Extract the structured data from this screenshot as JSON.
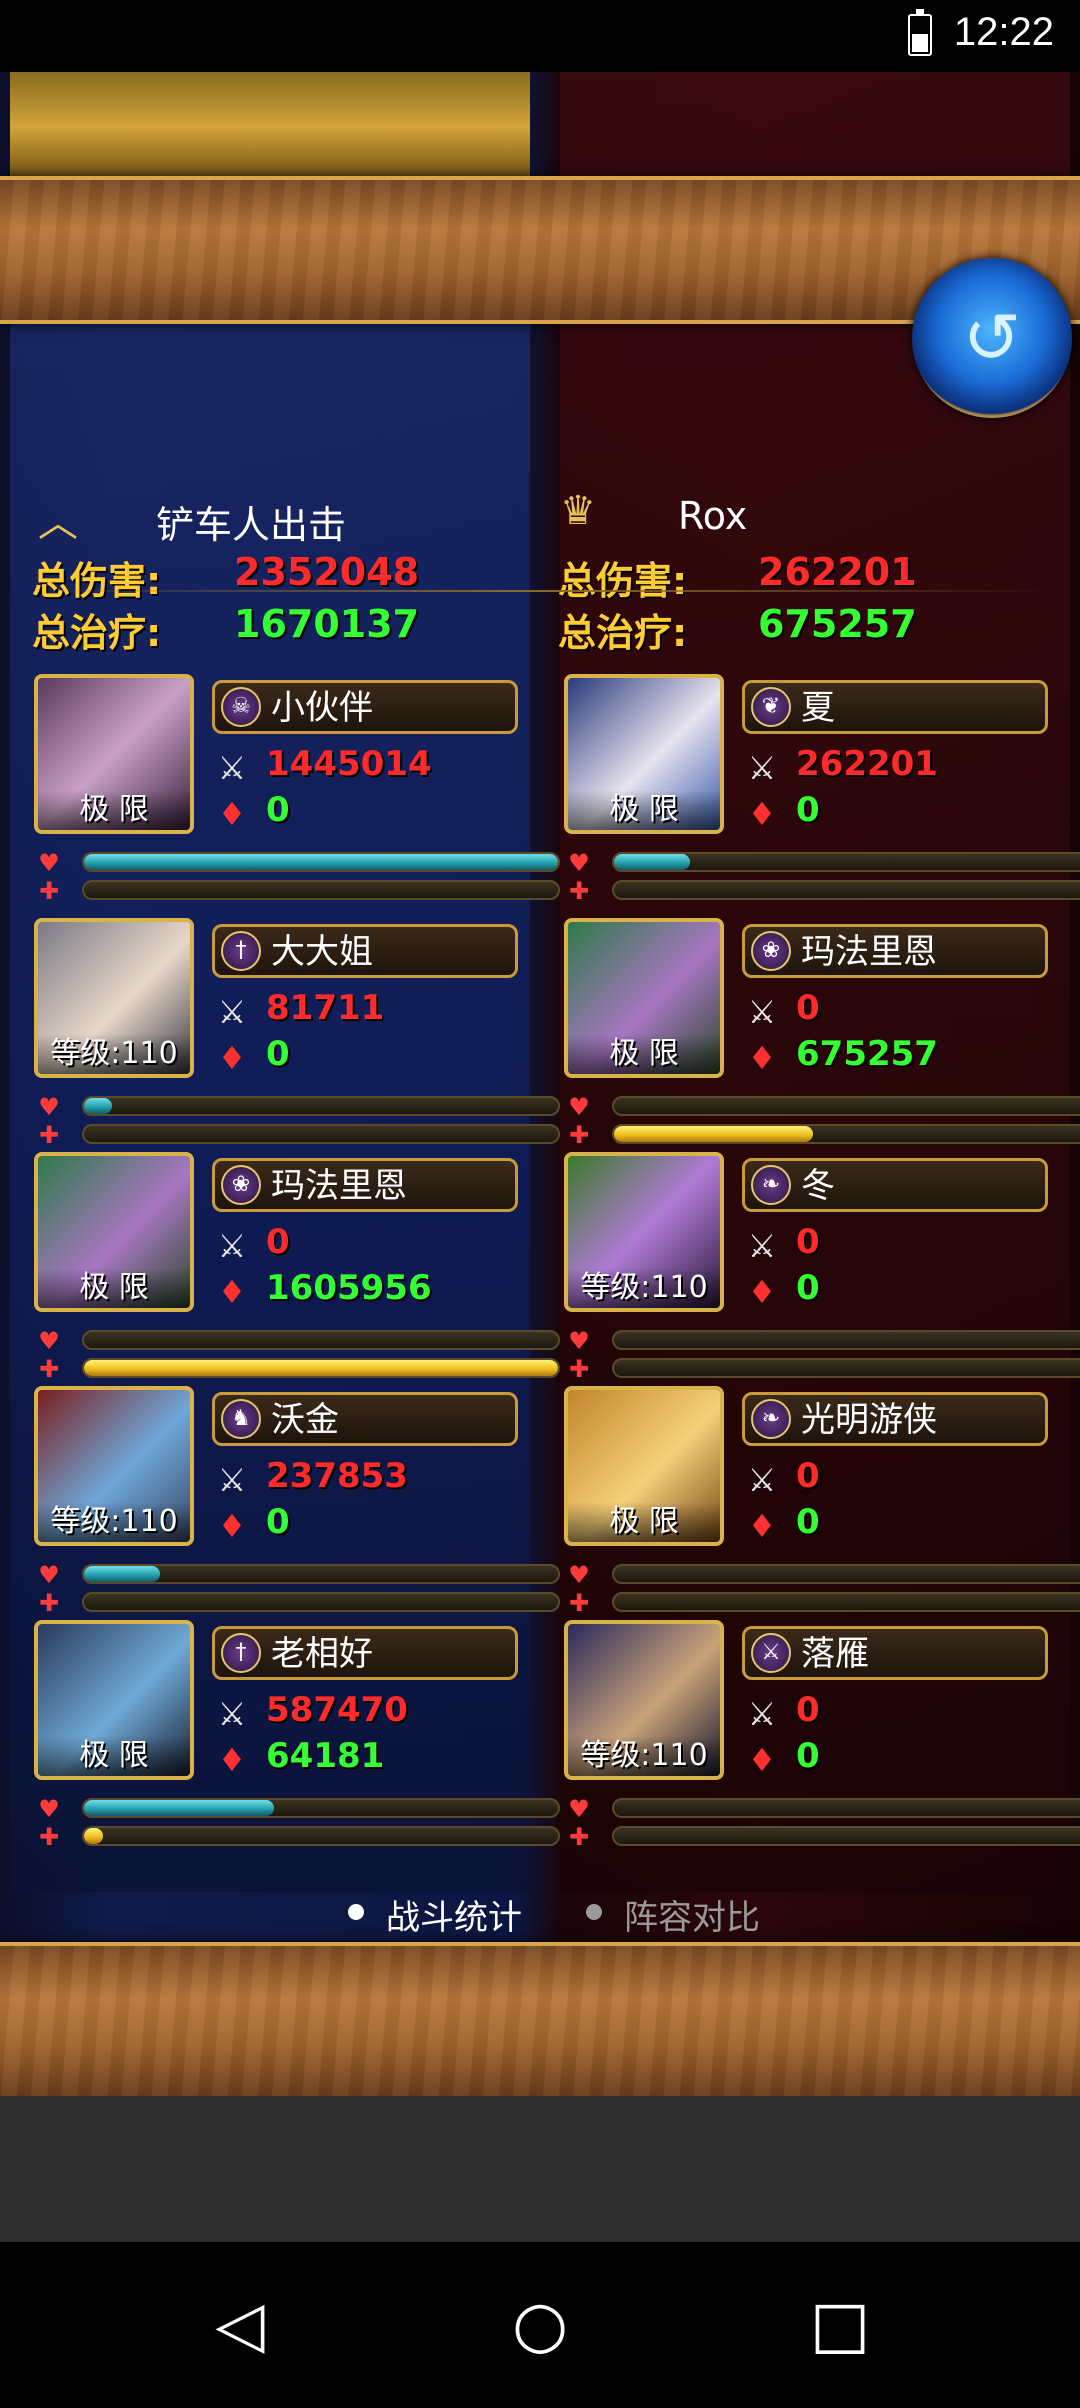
{
  "status_bar": {
    "time": "12:22",
    "battery_icon": "battery-icon"
  },
  "back_button": {
    "icon": "swirl-back-icon"
  },
  "left_team": {
    "name": "铲车人出击",
    "total_damage_label": "总伤害:",
    "total_damage": "2352048",
    "total_heal_label": "总治疗:",
    "total_heal": "1670137",
    "heroes": [
      {
        "name": "小伙伴",
        "badge": "极 限",
        "damage": "1445014",
        "heal": "0",
        "damage_fraction": 1.0,
        "heal_fraction": 0.0,
        "class_icon": "skull-icon"
      },
      {
        "name": "大大姐",
        "badge": "等级:110",
        "damage": "81711",
        "heal": "0",
        "damage_fraction": 0.06,
        "heal_fraction": 0.0,
        "class_icon": "dagger-icon"
      },
      {
        "name": "玛法里恩",
        "badge": "极 限",
        "damage": "0",
        "heal": "1605956",
        "damage_fraction": 0.0,
        "heal_fraction": 1.0,
        "class_icon": "paw-icon"
      },
      {
        "name": "沃金",
        "badge": "等级:110",
        "damage": "237853",
        "heal": "0",
        "damage_fraction": 0.16,
        "heal_fraction": 0.0,
        "class_icon": "warrior-icon"
      },
      {
        "name": "老相好",
        "badge": "极 限",
        "damage": "587470",
        "heal": "64181",
        "damage_fraction": 0.4,
        "heal_fraction": 0.04,
        "class_icon": "dagger-icon"
      }
    ]
  },
  "right_team": {
    "name": "Rox",
    "total_damage_label": "总伤害:",
    "total_damage": "262201",
    "total_heal_label": "总治疗:",
    "total_heal": "675257",
    "heroes": [
      {
        "name": "夏",
        "badge": "极 限",
        "damage": "262201",
        "heal": "0",
        "damage_fraction": 0.16,
        "heal_fraction": 0.0,
        "class_icon": "feather-icon"
      },
      {
        "name": "玛法里恩",
        "badge": "极 限",
        "damage": "0",
        "heal": "675257",
        "damage_fraction": 0.0,
        "heal_fraction": 0.42,
        "class_icon": "paw-icon"
      },
      {
        "name": "冬",
        "badge": "等级:110",
        "damage": "0",
        "heal": "0",
        "damage_fraction": 0.0,
        "heal_fraction": 0.0,
        "class_icon": "leaf-icon"
      },
      {
        "name": "光明游侠",
        "badge": "极 限",
        "damage": "0",
        "heal": "0",
        "damage_fraction": 0.0,
        "heal_fraction": 0.0,
        "class_icon": "leaf-icon"
      },
      {
        "name": "落雁",
        "badge": "等级:110",
        "damage": "0",
        "heal": "0",
        "damage_fraction": 0.0,
        "heal_fraction": 0.0,
        "class_icon": "crossed-swords-icon"
      }
    ]
  },
  "tabs": [
    {
      "label": "战斗统计",
      "active": true
    },
    {
      "label": "阵容对比",
      "active": false
    }
  ],
  "nav": {
    "back": "back-icon",
    "home": "home-icon",
    "recents": "recents-icon"
  },
  "colors": {
    "damage": "#ff2a2a",
    "heal": "#33ff33",
    "label_gold": "#ffcc33",
    "bar_damage": "#1f9aa8",
    "bar_heal": "#f0c020"
  }
}
